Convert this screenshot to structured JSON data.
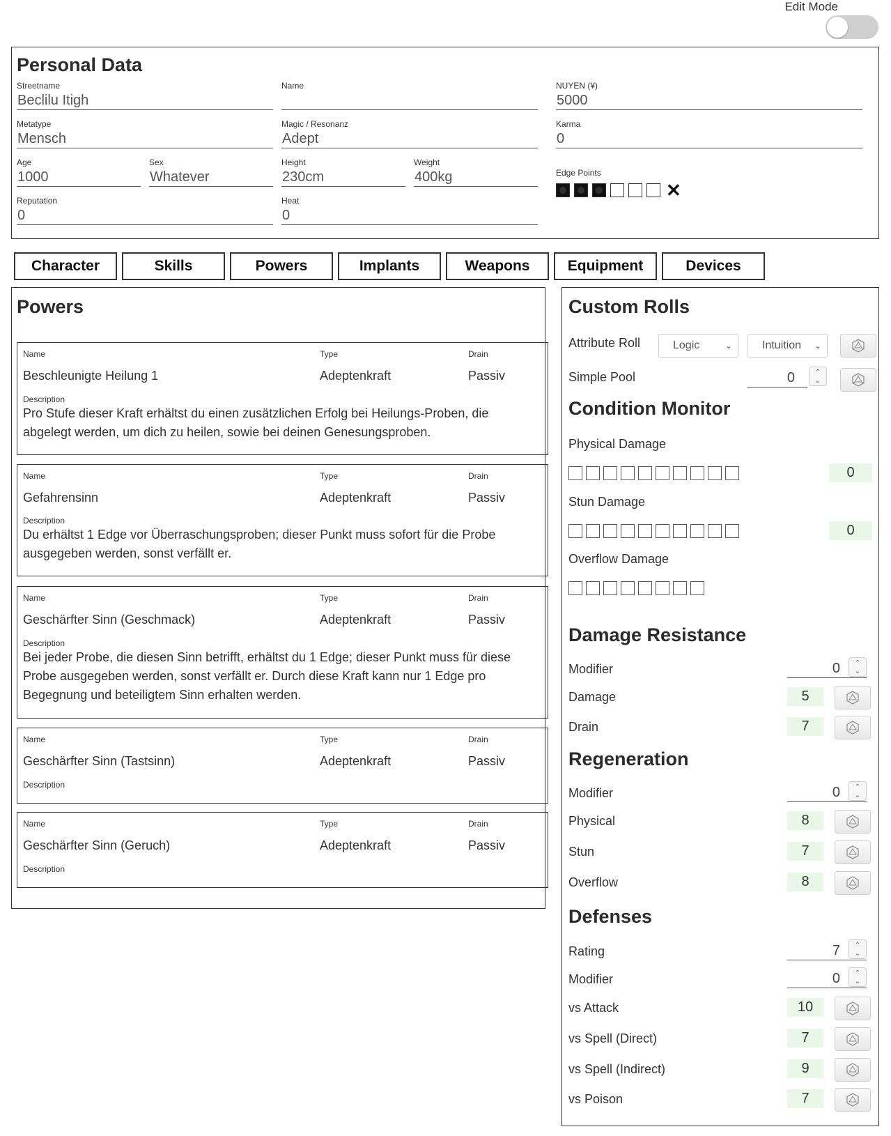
{
  "edit_mode": {
    "label": "Edit Mode",
    "on": false
  },
  "personal": {
    "title": "Personal Data",
    "streetname": {
      "label": "Streetname",
      "value": "Beclilu Itigh"
    },
    "name": {
      "label": "Name",
      "value": ""
    },
    "nuyen": {
      "label": "NUYEN (¥)",
      "value": "5000"
    },
    "metatype": {
      "label": "Metatype",
      "value": "Mensch"
    },
    "magic": {
      "label": "Magic / Resonanz",
      "value": "Adept"
    },
    "karma": {
      "label": "Karma",
      "value": "0"
    },
    "age": {
      "label": "Age",
      "value": "1000"
    },
    "sex": {
      "label": "Sex",
      "value": "Whatever"
    },
    "height": {
      "label": "Height",
      "value": "230cm"
    },
    "weight": {
      "label": "Weight",
      "value": "400kg"
    },
    "edge": {
      "label": "Edge Points",
      "filled": 3,
      "total": 6,
      "clear_symbol": "✕"
    },
    "reputation": {
      "label": "Reputation",
      "value": "0"
    },
    "heat": {
      "label": "Heat",
      "value": "0"
    }
  },
  "tabs": [
    "Character",
    "Skills",
    "Powers",
    "Implants",
    "Weapons",
    "Equipment",
    "Devices"
  ],
  "powers": {
    "title": "Powers",
    "labels": {
      "name": "Name",
      "type": "Type",
      "drain": "Drain",
      "description": "Description"
    },
    "items": [
      {
        "name": "Beschleunigte Heilung 1",
        "type": "Adeptenkraft",
        "drain": "Passiv",
        "description": "Pro Stufe dieser Kraft erhältst du einen zusätzlichen Erfolg bei Heilungs-Proben, die abgelegt werden, um dich zu heilen, sowie bei deinen Genesungsproben."
      },
      {
        "name": "Gefahrensinn",
        "type": "Adeptenkraft",
        "drain": "Passiv",
        "description": "Du erhältst 1 Edge vor Überraschungsproben; dieser Punkt muss sofort für die Probe ausgegeben werden, sonst verfällt er."
      },
      {
        "name": "Geschärfter Sinn (Geschmack)",
        "type": "Adeptenkraft",
        "drain": "Passiv",
        "description": "Bei jeder Probe, die diesen Sinn betrifft, erhältst du 1 Edge; dieser Punkt muss für diese Probe ausgegeben werden, sonst verfällt er. Durch diese Kraft kann nur 1 Edge pro Begegnung und beteiligtem Sinn erhalten werden."
      },
      {
        "name": "Geschärfter Sinn (Tastsinn)",
        "type": "Adeptenkraft",
        "drain": "Passiv",
        "description": ""
      },
      {
        "name": "Geschärfter Sinn (Geruch)",
        "type": "Adeptenkraft",
        "drain": "Passiv",
        "description": ""
      }
    ]
  },
  "custom_rolls": {
    "title": "Custom Rolls",
    "attribute_roll": {
      "label": "Attribute Roll",
      "attr1": "Logic",
      "attr2": "Intuition"
    },
    "simple_pool": {
      "label": "Simple Pool",
      "value": "0"
    }
  },
  "condition_monitor": {
    "title": "Condition Monitor",
    "physical": {
      "label": "Physical Damage",
      "boxes": 10,
      "value": "0"
    },
    "stun": {
      "label": "Stun Damage",
      "boxes": 10,
      "value": "0"
    },
    "overflow": {
      "label": "Overflow Damage",
      "boxes": 8
    }
  },
  "damage_resistance": {
    "title": "Damage Resistance",
    "modifier": {
      "label": "Modifier",
      "value": "0"
    },
    "damage": {
      "label": "Damage",
      "value": "5"
    },
    "drain": {
      "label": "Drain",
      "value": "7"
    }
  },
  "regeneration": {
    "title": "Regeneration",
    "modifier": {
      "label": "Modifier",
      "value": "0"
    },
    "physical": {
      "label": "Physical",
      "value": "8"
    },
    "stun": {
      "label": "Stun",
      "value": "7"
    },
    "overflow": {
      "label": "Overflow",
      "value": "8"
    }
  },
  "defenses": {
    "title": "Defenses",
    "rating": {
      "label": "Rating",
      "value": "7"
    },
    "modifier": {
      "label": "Modifier",
      "value": "0"
    },
    "vs_attack": {
      "label": "vs Attack",
      "value": "10"
    },
    "vs_spell_direct": {
      "label": "vs Spell (Direct)",
      "value": "7"
    },
    "vs_spell_indirect": {
      "label": "vs Spell (Indirect)",
      "value": "9"
    },
    "vs_poison": {
      "label": "vs Poison",
      "value": "7"
    }
  },
  "icons": {
    "dice": "d20-dice-icon",
    "chevron": "chevron-down-icon",
    "spinner": "spinner-arrows-icon"
  }
}
